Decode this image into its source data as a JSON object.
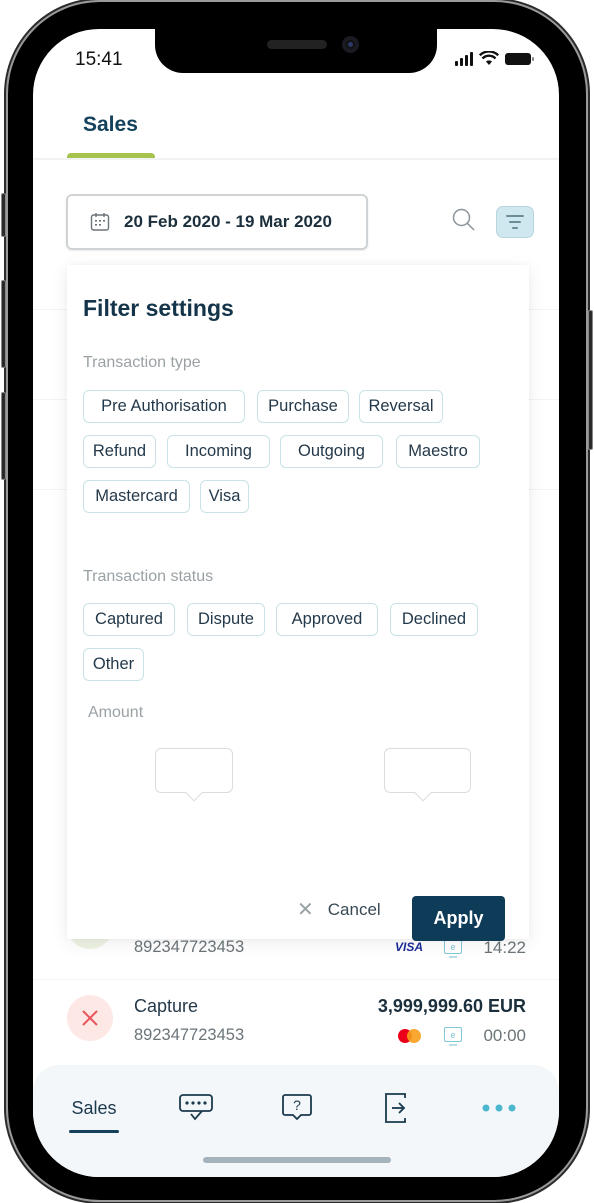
{
  "status_bar": {
    "time": "15:41"
  },
  "header": {
    "tab_label": "Sales"
  },
  "date_range": {
    "label": "20 Feb 2020 - 19 Mar 2020"
  },
  "filter_panel": {
    "title": "Filter settings",
    "transaction_type": {
      "label": "Transaction type",
      "chips": [
        "Pre Authorisation",
        "Purchase",
        "Reversal",
        "Refund",
        "Incoming",
        "Outgoing",
        "Maestro",
        "Mastercard",
        "Visa"
      ]
    },
    "transaction_status": {
      "label": "Transaction status",
      "chips": [
        "Captured",
        "Dispute",
        "Approved",
        "Declined",
        "Other"
      ]
    },
    "amount": {
      "label": "Amount",
      "min_value": "",
      "max_value": ""
    },
    "cancel_label": "Cancel",
    "apply_label": "Apply"
  },
  "transactions": [
    {
      "title": "",
      "id": "892347723453",
      "amount": "",
      "brand": "VISA",
      "time": "14:22",
      "status": "approved"
    },
    {
      "title": "Capture",
      "id": "892347723453",
      "amount": "3,999,999.60 EUR",
      "brand": "mastercard",
      "time": "00:00",
      "status": "declined"
    }
  ],
  "bottom_nav": {
    "items": [
      {
        "label": "Sales",
        "icon": "sales",
        "active": true
      },
      {
        "label": "",
        "icon": "pin-verify-icon"
      },
      {
        "label": "",
        "icon": "help-chat-icon"
      },
      {
        "label": "",
        "icon": "logout-icon"
      },
      {
        "label": "",
        "icon": "more-icon"
      }
    ]
  },
  "colors": {
    "primary": "#0e3b58",
    "accent_green": "#a6c34e",
    "chip_border": "#c9e2e6",
    "filter_active_bg": "#cfe7ee",
    "declined_bg": "#fde8e6",
    "declined_icon": "#e8545a",
    "more_dots": "#4db6cf"
  }
}
